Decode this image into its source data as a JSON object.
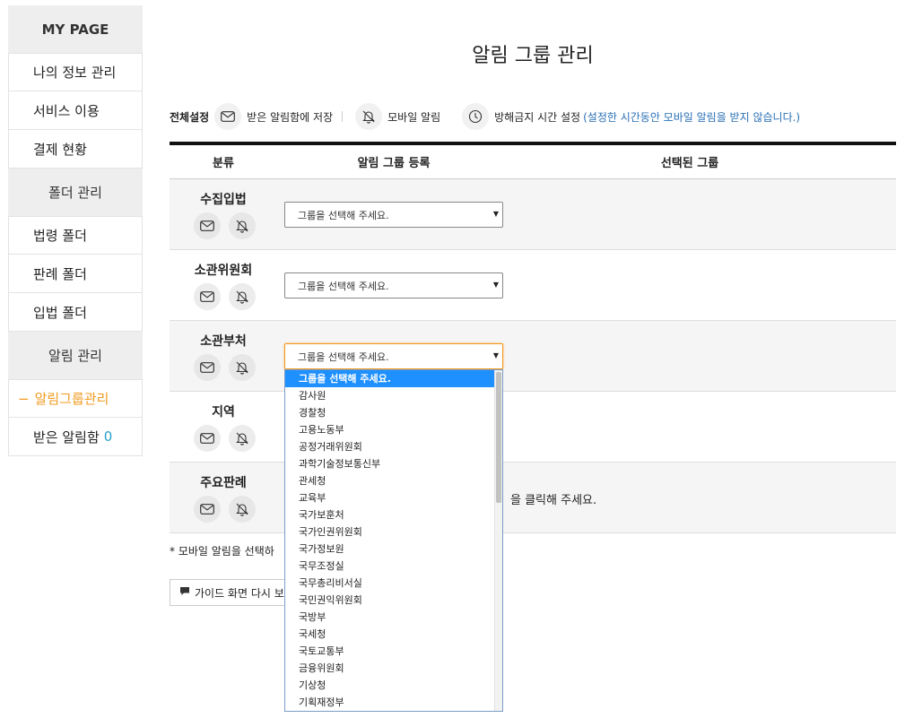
{
  "sidebar": {
    "heading": "MY PAGE",
    "items1": [
      "나의 정보 관리",
      "서비스 이용",
      "결제 현황"
    ],
    "folder_section": "폴더 관리",
    "items2": [
      "법령 폴더",
      "판례 폴더",
      "입법 폴더"
    ],
    "alert_section": "알림 관리",
    "active_item": "알림그룹관리",
    "active_prefix": "−",
    "inbox_item": "받은 알림함",
    "inbox_count": "0"
  },
  "page_title": "알림 그룹 관리",
  "settings": {
    "label": "전체설정",
    "inbox_save": "받은 알림함에 저장",
    "mobile_alert": "모바일 알림",
    "dnd_label": "방해금지 시간 설정",
    "dnd_note": "(설정한 시간동안 모바일 알림을 받지 않습니다.)"
  },
  "table": {
    "headers": {
      "category": "분류",
      "register": "알림 그룹 등록",
      "selected": "선택된 그룹"
    },
    "rows": [
      {
        "name": "수집입법",
        "select": "그룹을 선택해 주세요."
      },
      {
        "name": "소관위원회",
        "select": "그룹을 선택해 주세요."
      },
      {
        "name": "소관부처",
        "select": "그룹을 선택해 주세요."
      },
      {
        "name": "지역",
        "select": ""
      },
      {
        "name": "주요판례",
        "select": "",
        "hint": "을 클릭해 주세요."
      }
    ]
  },
  "footnote": "* 모바일 알림을 선택하",
  "guide_button": "가이드 화면 다시 보",
  "dropdown": {
    "selected": "그룹을 선택해 주세요.",
    "options": [
      "그룹을 선택해 주세요.",
      "감사원",
      "경찰청",
      "고용노동부",
      "공정거래위원회",
      "과학기술정보통신부",
      "관세청",
      "교육부",
      "국가보훈처",
      "국가인권위원회",
      "국가정보원",
      "국무조정실",
      "국무총리비서실",
      "국민권익위원회",
      "국방부",
      "국세청",
      "국토교통부",
      "금융위원회",
      "기상청",
      "기획재정부"
    ]
  }
}
